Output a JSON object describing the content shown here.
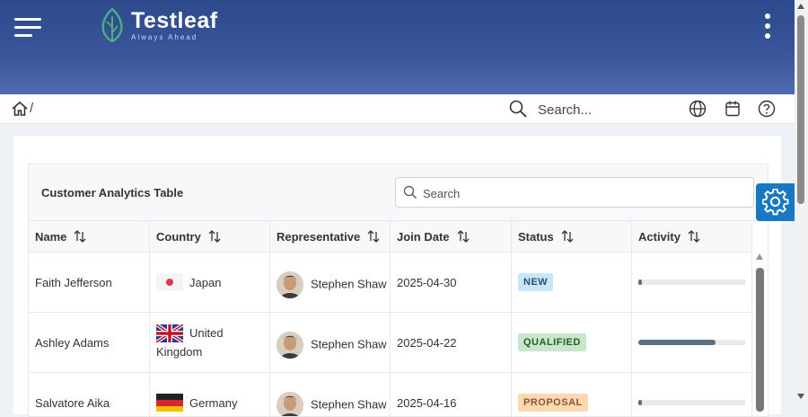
{
  "header": {
    "brand": "Testleaf",
    "tagline": "Always Ahead"
  },
  "toolbar": {
    "breadcrumb_sep": "/",
    "search_placeholder": "Search..."
  },
  "table": {
    "caption": "Customer Analytics Table",
    "search_placeholder": "Search",
    "columns": [
      "Name",
      "Country",
      "Representative",
      "Join Date",
      "Status",
      "Activity"
    ],
    "rows": [
      {
        "name": "Faith Jefferson",
        "country": "Japan",
        "country_flag": "japan-flag",
        "representative": "Stephen Shaw",
        "join_date": "2025-04-30",
        "status": "NEW",
        "status_bg": "#c8e6f7",
        "status_fg": "#23547b",
        "activity": 0.03
      },
      {
        "name": "Ashley Adams",
        "country": "United Kingdom",
        "country_flag": "uk-flag",
        "representative": "Stephen Shaw",
        "join_date": "2025-04-22",
        "status": "QUALIFIED",
        "status_bg": "#c8e6c9",
        "status_fg": "#256029",
        "activity": 0.72
      },
      {
        "name": "Salvatore Aika",
        "country": "Germany",
        "country_flag": "germany-flag",
        "representative": "Stephen Shaw",
        "join_date": "2025-04-16",
        "status": "PROPOSAL",
        "status_bg": "#ffd8b2",
        "status_fg": "#805b36",
        "activity": 0.02
      }
    ]
  },
  "colors": {
    "header_gradient_top": "#2c4a8c",
    "header_gradient_bottom": "#4f6aad",
    "settings_button": "#1a78c2",
    "activity_fill": "#5b7183"
  }
}
